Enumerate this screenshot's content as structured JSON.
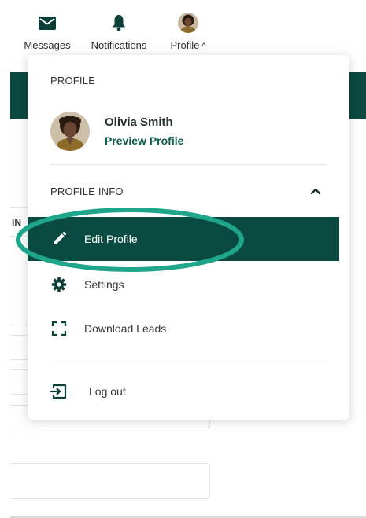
{
  "nav": {
    "messages": {
      "label": "Messages",
      "icon": "envelope-icon"
    },
    "notifications": {
      "label": "Notifications",
      "icon": "bell-icon"
    },
    "profile": {
      "label": "Profile",
      "icon": "avatar",
      "chevron": "^"
    }
  },
  "background": {
    "truncated_label": "IN"
  },
  "dropdown": {
    "profile_heading": "PROFILE",
    "user": {
      "name": "Olivia Smith",
      "preview_link": "Preview Profile"
    },
    "profile_info_heading": "PROFILE INFO",
    "collapse_icon": "chevron-up-icon",
    "items": [
      {
        "label": "Edit Profile",
        "icon": "pencil-icon",
        "active": true
      },
      {
        "label": "Settings",
        "icon": "gear-icon",
        "active": false
      },
      {
        "label": "Download Leads",
        "icon": "scan-frame-icon",
        "active": false
      },
      {
        "label": "Log out",
        "icon": "logout-icon",
        "active": false
      }
    ]
  },
  "colors": {
    "brand_dark_green": "#0a4a40",
    "link_green": "#0d5a4c",
    "highlight_ring": "#1fa58a"
  }
}
